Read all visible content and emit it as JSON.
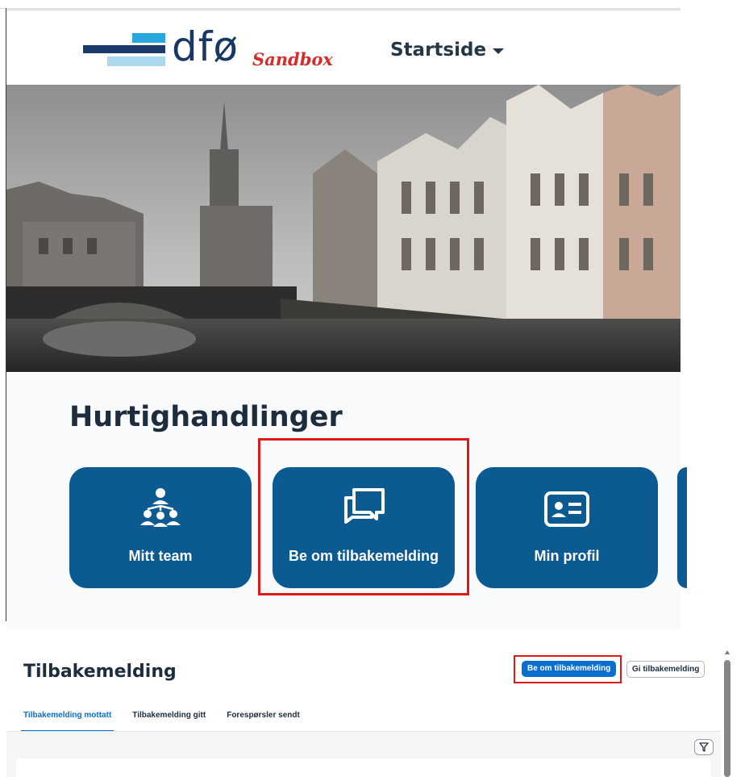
{
  "top_app": {
    "logo_text": "dfø",
    "logo_badge": "Sandbox",
    "nav_start_label": "Startside",
    "quick_actions_title": "Hurtighandlinger",
    "tiles": [
      {
        "label": "Mitt team",
        "icon": "team-icon"
      },
      {
        "label": "Be om tilbakemelding",
        "icon": "feedback-chat-icon"
      },
      {
        "label": "Min profil",
        "icon": "profile-card-icon"
      }
    ]
  },
  "feedback_app": {
    "title": "Tilbakemelding",
    "request_button": "Be om tilbakemelding",
    "give_button": "Gi tilbakemelding",
    "tabs": [
      {
        "label": "Tilbakemelding mottatt",
        "active": true
      },
      {
        "label": "Tilbakemelding gitt",
        "active": false
      },
      {
        "label": "Forespørsler sendt",
        "active": false
      }
    ]
  },
  "colors": {
    "tile_blue": "#0b5a92",
    "primary_blue": "#0a6ed1",
    "highlight_red": "#e01818",
    "logo_navy": "#173864",
    "sandbox_red": "#d72a2a"
  }
}
